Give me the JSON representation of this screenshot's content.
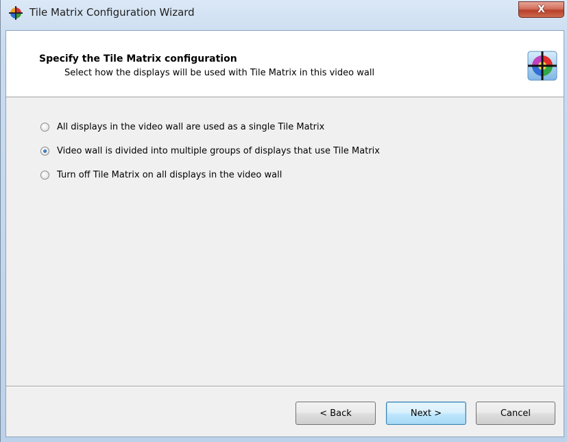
{
  "window": {
    "title": "Tile Matrix Configuration Wizard",
    "close_label": "X"
  },
  "header": {
    "title": "Specify the Tile Matrix configuration",
    "subtitle": "Select how the displays will be used with Tile Matrix in this video wall"
  },
  "options": [
    {
      "label": "All displays in the video wall are used as a single Tile Matrix",
      "checked": false
    },
    {
      "label": "Video wall is divided into multiple groups of displays that use Tile Matrix",
      "checked": true
    },
    {
      "label": "Turn off Tile Matrix on all displays in the video wall",
      "checked": false
    }
  ],
  "buttons": {
    "back": "< Back",
    "next": "Next >",
    "cancel": "Cancel"
  },
  "colors": {
    "accent": "#3c7fb1",
    "close_button": "#c7503a"
  }
}
